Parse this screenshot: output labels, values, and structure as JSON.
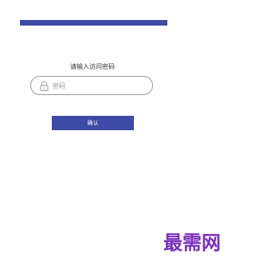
{
  "header": {
    "bar_color": "#3d4aa6"
  },
  "form": {
    "prompt": "请输入访问密码",
    "password": {
      "placeholder": "密码",
      "value": "",
      "icon": "lock-icon"
    },
    "confirm_label": "确认"
  },
  "watermark": {
    "text": "最需网",
    "color": "#7c2dbd"
  }
}
